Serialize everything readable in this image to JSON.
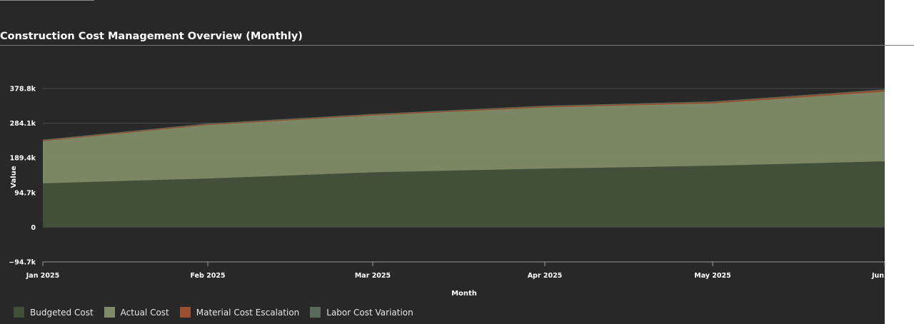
{
  "title": "Construction Cost Management Overview (Monthly)",
  "chart_data": {
    "type": "area",
    "stacked": true,
    "xlabel": "Month",
    "ylabel": "Value",
    "categories": [
      "Jan 2025",
      "Feb 2025",
      "Mar 2025",
      "Apr 2025",
      "May 2025",
      "Jun"
    ],
    "ylim": [
      -94.7,
      378.8
    ],
    "yticks": [
      {
        "value": 378.8,
        "label": "378.8k"
      },
      {
        "value": 284.1,
        "label": "284.1k"
      },
      {
        "value": 189.4,
        "label": "189.4k"
      },
      {
        "value": 94.7,
        "label": "94.7k"
      },
      {
        "value": 0,
        "label": "0"
      },
      {
        "value": -94.7,
        "label": "−94.7k"
      }
    ],
    "grid": true,
    "legend_position": "bottom-left",
    "series": [
      {
        "name": "Budgeted Cost",
        "color": "#435039",
        "values": [
          120,
          133,
          150,
          160,
          168,
          180
        ]
      },
      {
        "name": "Actual Cost",
        "color": "#7f8c67",
        "values": [
          115,
          146,
          155,
          167,
          170,
          190
        ]
      },
      {
        "name": "Material Cost Escalation",
        "color": "#9b4f2f",
        "values": [
          2.4,
          2.5,
          2.6,
          3.0,
          3.6,
          4.5
        ]
      },
      {
        "name": "Labor Cost Variation",
        "color": "#5a6a5a",
        "values": [
          0.8,
          0.8,
          0.9,
          0.9,
          0.9,
          1.0
        ]
      }
    ]
  }
}
